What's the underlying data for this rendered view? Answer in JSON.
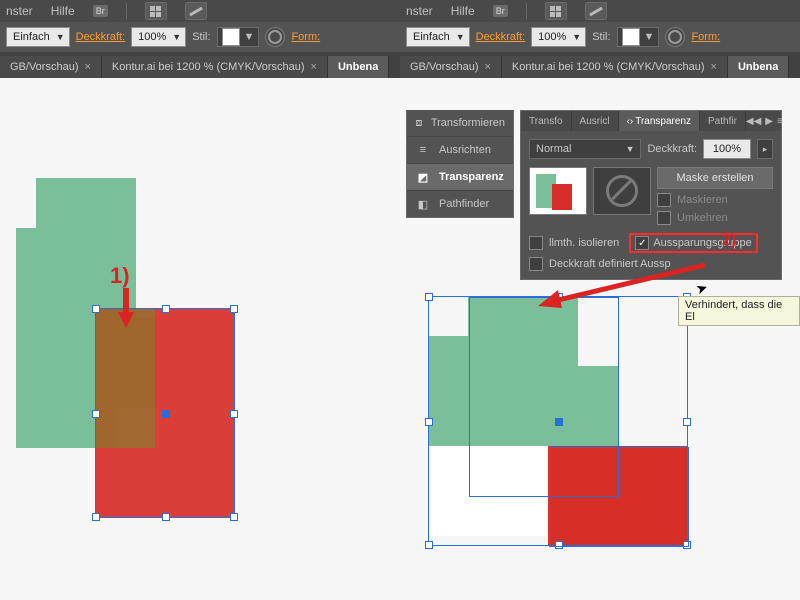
{
  "menu": {
    "fenster": "nster",
    "hilfe": "Hilfe",
    "br": "Br"
  },
  "opt": {
    "einfach": "Einfach",
    "deckkraft": "Deckkraft:",
    "deckkraft_val": "100%",
    "stil": "Stil:",
    "form": "Form:"
  },
  "tabs": {
    "t1": "GB/Vorschau)",
    "t2": "Kontur.ai bei 1200 % (CMYK/Vorschau)",
    "t3": "Unbena"
  },
  "annot": {
    "one": "1)",
    "two": "2)"
  },
  "collapsed": {
    "transform": "Transformieren",
    "ausrichten": "Ausrichten",
    "transparenz": "Transparenz",
    "pathfinder": "Pathfinder"
  },
  "panel": {
    "tabs": {
      "transf": "Transfo",
      "ausri": "Ausricl",
      "transp": "Transparenz",
      "pathf": "Pathfir"
    },
    "blend": "Normal",
    "deckkraft_label": "Deckkraft:",
    "deckkraft_val": "100%",
    "maske": "Maske erstellen",
    "maskieren": "Maskieren",
    "umkehren": "Umkehren",
    "isolieren": "llmth. isolieren",
    "aussp": "Aussparungsgruppe",
    "deck_def": "Deckkraft definiert Aussp"
  },
  "tooltip": "Verhindert, dass die El"
}
